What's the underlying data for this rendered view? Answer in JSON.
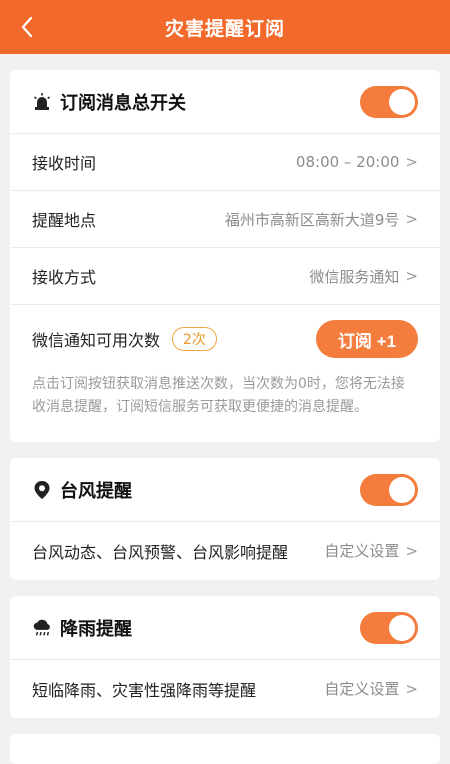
{
  "header": {
    "title": "灾害提醒订阅",
    "back_icon": "chevron-left-icon"
  },
  "master": {
    "title": "订阅消息总开关",
    "toggle_on": true,
    "rows": [
      {
        "label": "接收时间",
        "value": "08:00 – 20:00"
      },
      {
        "label": "提醒地点",
        "value": "福州市高新区高新大道9号"
      },
      {
        "label": "接收方式",
        "value": "微信服务通知"
      }
    ],
    "quota_label": "微信通知可用次数",
    "quota_badge": "2次",
    "subscribe_button": "订阅 +1",
    "note": "点击订阅按钮获取消息推送次数，当次数为0时，您将无法接收消息提醒，订阅短信服务可获取更便捷的消息提醒。"
  },
  "typhoon": {
    "title": "台风提醒",
    "toggle_on": true,
    "desc": "台风动态、台风预警、台风影响提醒",
    "setting": "自定义设置"
  },
  "rain": {
    "title": "降雨提醒",
    "toggle_on": true,
    "desc": "短临降雨、灾害性强降雨等提醒",
    "setting": "自定义设置"
  },
  "chevron": ">",
  "colors": {
    "accent": "#f26a2b",
    "toggle": "#f47c3c",
    "badge": "#e99a2a"
  }
}
